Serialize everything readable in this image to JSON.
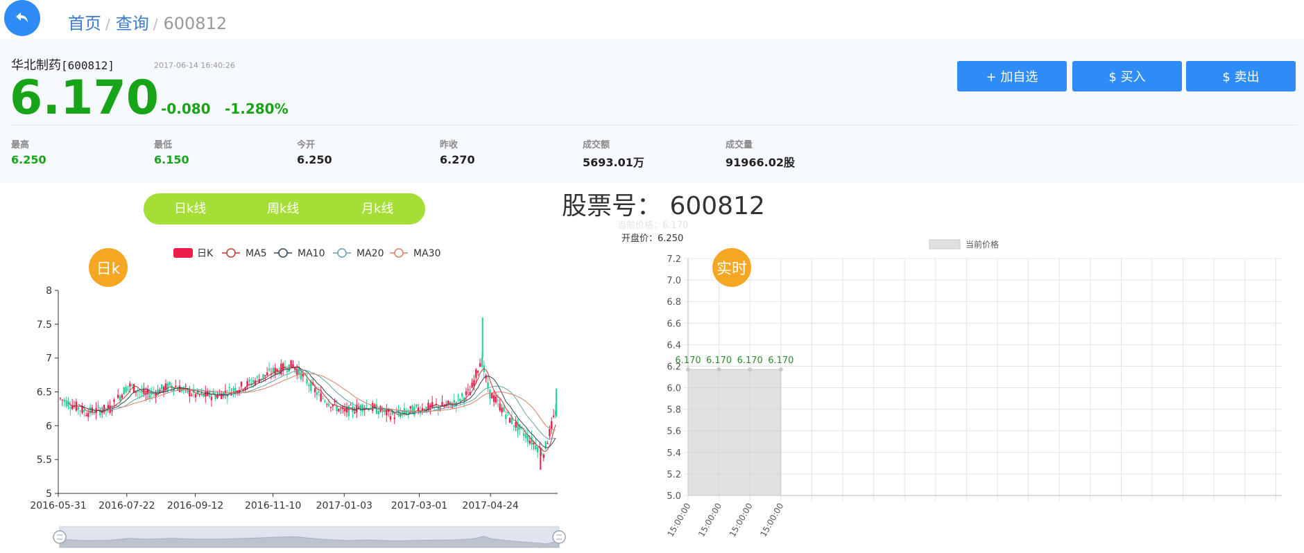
{
  "breadcrumb": {
    "home": "首页",
    "query": "查询",
    "code": "600812",
    "sep": "/"
  },
  "stock": {
    "name": "华北制药",
    "code_bracket": "[600812]",
    "time": "2017-06-14 16:40:26",
    "price": "6.170",
    "change": "-0.080",
    "change_pct": "-1.280%"
  },
  "buttons": {
    "add": "+ 加自选",
    "buy": "$ 买入",
    "sell": "$ 卖出"
  },
  "stats": [
    {
      "label": "最高",
      "value": "6.250"
    },
    {
      "label": "最低",
      "value": "6.150"
    },
    {
      "label": "今开",
      "value": "6.250"
    },
    {
      "label": "昨收",
      "value": "6.270"
    },
    {
      "label": "成交额",
      "value": "5693.01万"
    },
    {
      "label": "成交量",
      "value": "91966.02股"
    }
  ],
  "ktabs": [
    "日k线",
    "周k线",
    "月k线"
  ],
  "title": {
    "prefix": "股票号：",
    "code": "600812"
  },
  "current_price_label": "当前价格：",
  "current_price_value": "6.170",
  "open_label": "开盘价：",
  "open_value": "6.250",
  "colors": {
    "up": "#ee1c4b",
    "down": "#21d29c",
    "green": "#18a418",
    "blue": "#2f8cf6",
    "ma5": "#c23531",
    "ma10": "#2f4554",
    "ma20": "#61a0a8",
    "ma30": "#d48265"
  },
  "icons": {
    "back": "back-arrow-icon"
  },
  "chart_data": [
    {
      "type": "candlestick",
      "badge": "日k",
      "legend": [
        "日K",
        "MA5",
        "MA10",
        "MA20",
        "MA30"
      ],
      "x_ticks": [
        "2016-05-31",
        "2016-07-22",
        "2016-09-12",
        "2016-11-10",
        "2017-01-03",
        "2017-03-01",
        "2017-04-24"
      ],
      "y_ticks": [
        "5",
        "5.5",
        "6",
        "6.5",
        "7",
        "7.5",
        "8"
      ],
      "ylim": [
        5,
        8
      ],
      "close_path": [
        [
          "2016-05-31",
          6.4
        ],
        [
          "2016-06-20",
          6.2
        ],
        [
          "2016-07-08",
          6.25
        ],
        [
          "2016-07-22",
          6.6
        ],
        [
          "2016-08-05",
          6.45
        ],
        [
          "2016-08-25",
          6.6
        ],
        [
          "2016-09-12",
          6.45
        ],
        [
          "2016-09-28",
          6.45
        ],
        [
          "2016-10-20",
          6.6
        ],
        [
          "2016-11-10",
          6.8
        ],
        [
          "2016-11-25",
          6.9
        ],
        [
          "2016-12-15",
          6.45
        ],
        [
          "2017-01-03",
          6.2
        ],
        [
          "2017-01-20",
          6.3
        ],
        [
          "2017-02-10",
          6.15
        ],
        [
          "2017-03-01",
          6.25
        ],
        [
          "2017-03-25",
          6.3
        ],
        [
          "2017-04-10",
          6.5
        ],
        [
          "2017-04-18",
          7.0
        ],
        [
          "2017-04-24",
          6.5
        ],
        [
          "2017-05-10",
          6.1
        ],
        [
          "2017-05-25",
          5.8
        ],
        [
          "2017-06-05",
          5.6
        ],
        [
          "2017-06-14",
          6.2
        ]
      ],
      "spikes": [
        [
          "2017-04-18",
          7.6
        ],
        [
          "2017-06-01",
          5.35
        ],
        [
          "2017-06-13",
          6.55
        ]
      ]
    },
    {
      "type": "area",
      "badge": "实时",
      "series": [
        {
          "name": "当前价格",
          "values": [
            6.17,
            6.17,
            6.17,
            6.17
          ]
        }
      ],
      "categories": [
        "15:00:00",
        "15:00:00",
        "15:00:00",
        "15:00:00"
      ],
      "data_labels": [
        "6.170",
        "6.170",
        "6.170",
        "6.170"
      ],
      "y_ticks": [
        "5.0",
        "5.2",
        "5.4",
        "5.6",
        "5.8",
        "6.0",
        "6.2",
        "6.4",
        "6.6",
        "6.8",
        "7.0",
        "7.2"
      ],
      "ylim": [
        5.0,
        7.2
      ]
    }
  ]
}
